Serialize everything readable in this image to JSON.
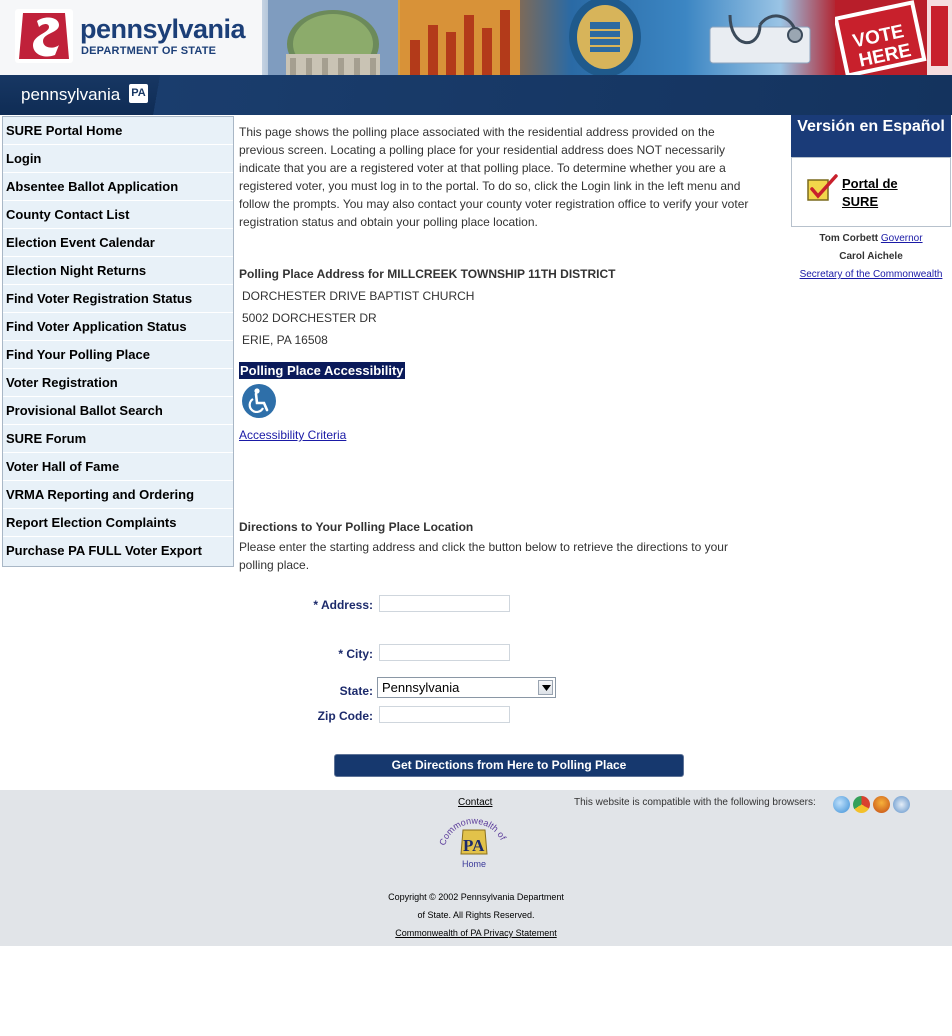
{
  "header": {
    "logo_title": "pennsylvania",
    "logo_subtitle": "DEPARTMENT OF STATE",
    "subbar_word": "pennsylvania",
    "subbar_badge": "PA",
    "banner_sign_line1": "VOTE",
    "banner_sign_line2": "HERE"
  },
  "sidebar": {
    "items": [
      {
        "label": "SURE Portal Home"
      },
      {
        "label": "Login"
      },
      {
        "label": "Absentee Ballot Application"
      },
      {
        "label": "County Contact List"
      },
      {
        "label": "Election Event Calendar"
      },
      {
        "label": "Election Night Returns"
      },
      {
        "label": "Find Voter Registration Status"
      },
      {
        "label": "Find Voter Application Status"
      },
      {
        "label": "Find Your Polling Place"
      },
      {
        "label": "Voter Registration"
      },
      {
        "label": "Provisional Ballot Search"
      },
      {
        "label": "SURE Forum"
      },
      {
        "label": "Voter Hall of Fame"
      },
      {
        "label": "VRMA Reporting and Ordering"
      },
      {
        "label": "Report Election Complaints"
      },
      {
        "label": "Purchase PA FULL Voter Export"
      }
    ]
  },
  "main": {
    "intro": "This page shows the polling place associated with the residential address provided on the previous screen. Locating a polling place for your residential address does NOT necessarily indicate that you are a registered voter at that polling place. To determine whether you are a registered voter, you must log in to the portal. To do so, click the Login link in the left menu and follow the prompts. You may also contact your county voter registration office to verify your voter registration status and obtain your polling place location.",
    "polling_heading": "Polling Place Address for MILLCREEK TOWNSHIP 11TH DISTRICT",
    "polling_name": "DORCHESTER DRIVE BAPTIST CHURCH",
    "polling_street": "5002 DORCHESTER DR",
    "polling_city": "ERIE, PA  16508",
    "accessibility_heading": "Polling Place Accessibility",
    "accessibility_link": "Accessibility Criteria",
    "directions_heading": "Directions to Your Polling Place Location",
    "directions_text": "Please enter the starting address and click the button below to retrieve the directions to your polling place.",
    "form": {
      "address_label": "* Address:",
      "address_value": "",
      "city_label": "* City:",
      "city_value": "",
      "state_label": "State:",
      "state_value": "Pennsylvania",
      "zip_label": "Zip Code:",
      "zip_value": ""
    },
    "button_label": "Get Directions from Here to Polling Place"
  },
  "right": {
    "espanol": "Versión en Español",
    "portal_line1": "Portal de",
    "portal_line2": "SURE",
    "governor_name": "Tom Corbett",
    "governor_title": "Governor",
    "secretary_name": "Carol Aichele",
    "secretary_title": "Secretary of the Commonwealth"
  },
  "footer": {
    "contact": "Contact",
    "compat": "This website is compatible with the following browsers:",
    "seal_text_top": "Commonwealth of",
    "seal_text_pa": "PA",
    "seal_text_home": "Home",
    "copyright_line1": "Copyright © 2002 Pennsylvania Department",
    "copyright_line2": "of State. All Rights Reserved.",
    "privacy": "Commonwealth of PA Privacy Statement",
    "browsers": [
      {
        "icon": "internet-explorer-icon",
        "color": "#3b8fd6"
      },
      {
        "icon": "chrome-icon",
        "color": "#d9412f"
      },
      {
        "icon": "firefox-icon",
        "color": "#e2761b"
      },
      {
        "icon": "safari-icon",
        "color": "#5a8fc8"
      }
    ]
  }
}
